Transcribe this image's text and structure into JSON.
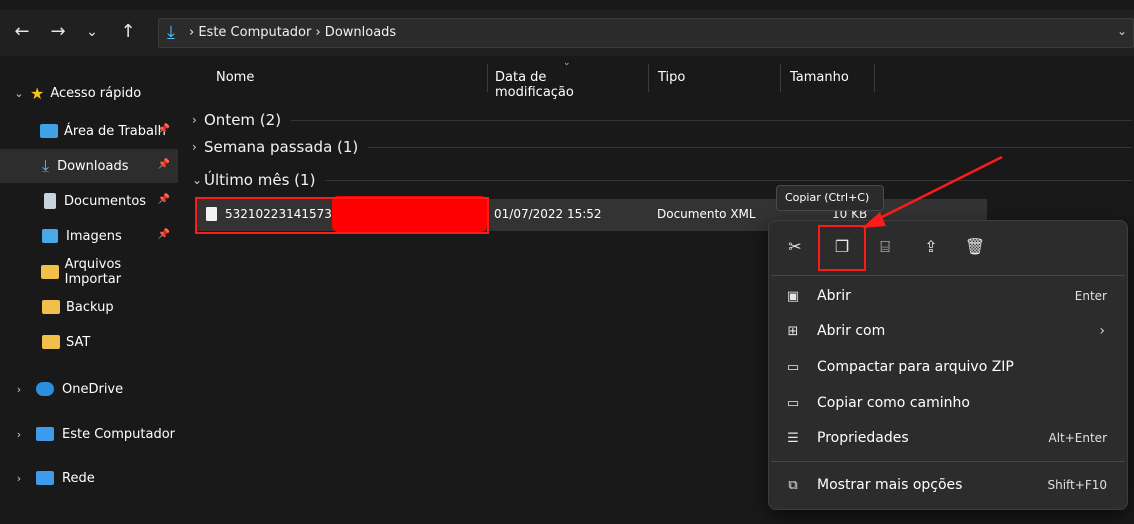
{
  "nav": {
    "back": "←",
    "forward": "→",
    "recent": "⌄",
    "up": "↑"
  },
  "address": {
    "path": "›  Este Computador  ›  Downloads",
    "dropdown": "⌄"
  },
  "sidebar": {
    "quick_access": "Acesso rápido",
    "items": [
      {
        "label": "Área de Trabalh",
        "icon": "desktop-icon",
        "pinned": true
      },
      {
        "label": "Downloads",
        "icon": "download-icon",
        "pinned": true
      },
      {
        "label": "Documentos",
        "icon": "documents-icon",
        "pinned": true
      },
      {
        "label": "Imagens",
        "icon": "images-icon",
        "pinned": true
      },
      {
        "label": "Arquivos Importar",
        "icon": "folder-icon",
        "pinned": false
      },
      {
        "label": "Backup",
        "icon": "folder-icon",
        "pinned": false
      },
      {
        "label": "SAT",
        "icon": "folder-icon",
        "pinned": false
      }
    ],
    "onedrive": "OneDrive",
    "this_pc": "Este Computador",
    "network": "Rede"
  },
  "columns": {
    "name": "Nome",
    "date": "Data de modificação",
    "type": "Tipo",
    "size": "Tamanho"
  },
  "groups": {
    "yesterday": "Ontem (2)",
    "last_week": "Semana passada (1)",
    "last_month": "Último mês (1)"
  },
  "file": {
    "name": "5321022314157300",
    "date": "01/07/2022 15:52",
    "type": "Documento XML",
    "size": "10 KB"
  },
  "tooltip": "Copiar (Ctrl+C)",
  "menu": {
    "open": "Abrir",
    "open_key": "Enter",
    "open_with": "Abrir com",
    "compress": "Compactar para arquivo ZIP",
    "copy_path": "Copiar como caminho",
    "properties": "Propriedades",
    "properties_key": "Alt+Enter",
    "more_options": "Mostrar mais opções",
    "more_key": "Shift+F10"
  },
  "colors": {
    "background": "#191919",
    "accent": "#4cc2ff",
    "folder": "#f0c04a",
    "highlight": "#ff1a1a"
  }
}
